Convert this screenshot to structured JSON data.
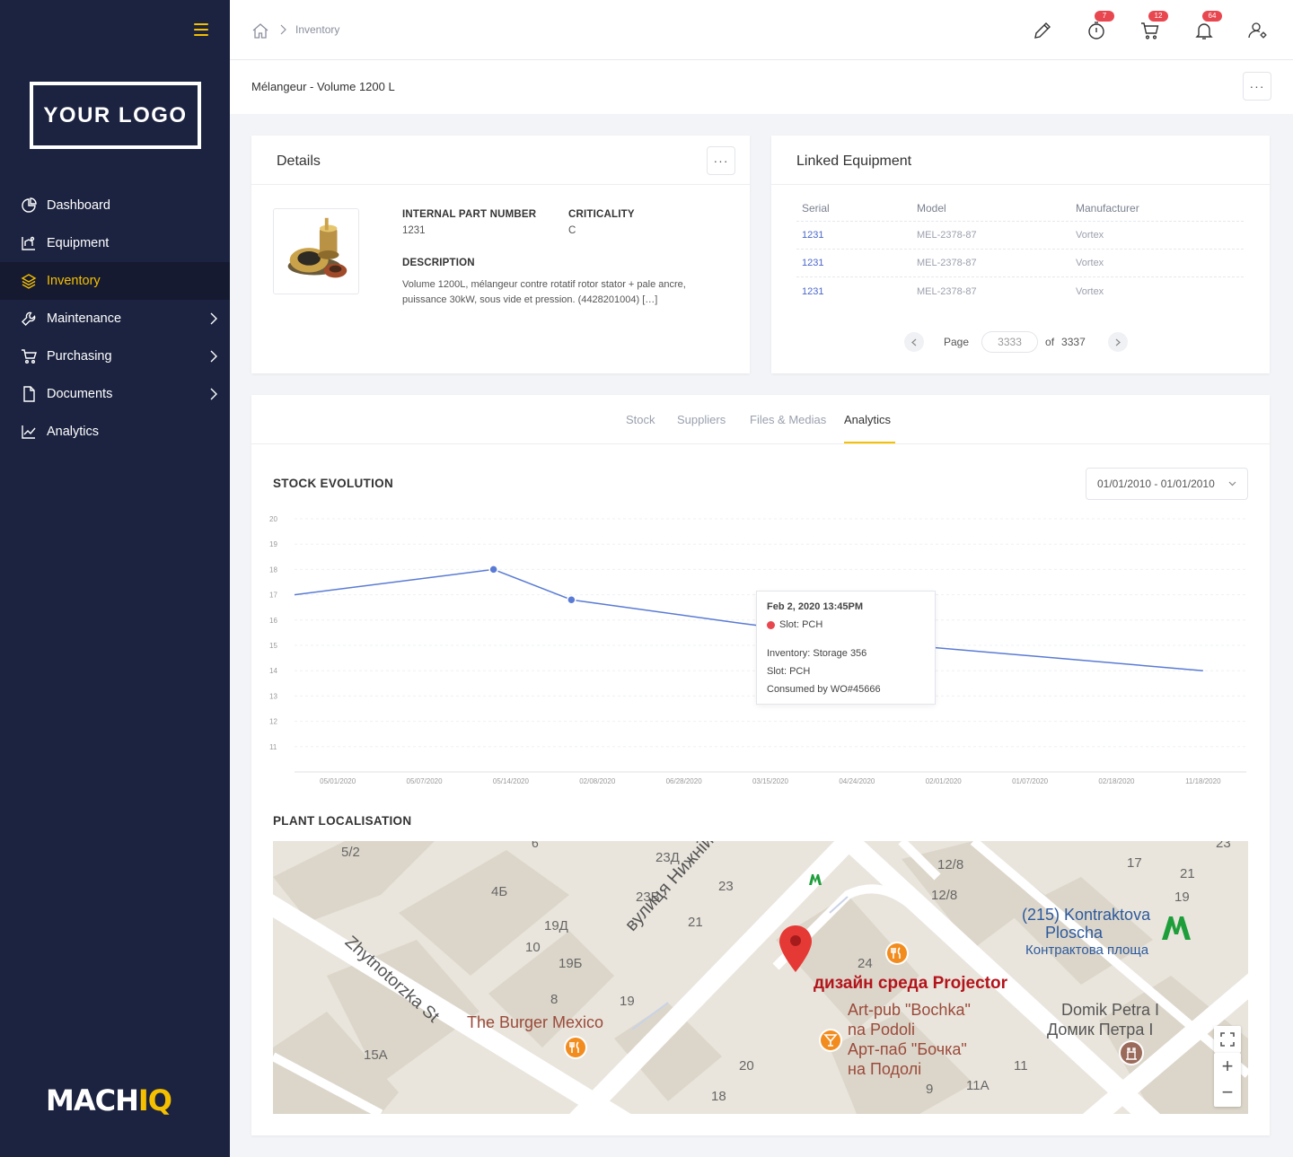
{
  "sidebar": {
    "logo_text": "YOUR LOGO",
    "items": [
      {
        "label": "Dashboard",
        "icon": "dashboard-icon",
        "active": false,
        "has_children": false
      },
      {
        "label": "Equipment",
        "icon": "equipment-icon",
        "active": false,
        "has_children": false
      },
      {
        "label": "Inventory",
        "icon": "inventory-layers-icon",
        "active": true,
        "has_children": false
      },
      {
        "label": "Maintenance",
        "icon": "wrench-icon",
        "active": false,
        "has_children": true
      },
      {
        "label": "Purchasing",
        "icon": "cart-icon",
        "active": false,
        "has_children": true
      },
      {
        "label": "Documents",
        "icon": "document-icon",
        "active": false,
        "has_children": true
      },
      {
        "label": "Analytics",
        "icon": "analytics-icon",
        "active": false,
        "has_children": false
      }
    ],
    "brand": {
      "part1": "MACH",
      "part2": "IQ"
    },
    "accent": "#f5c000",
    "background": "#1c2340"
  },
  "topbar": {
    "breadcrumb": "Inventory",
    "icons": [
      {
        "name": "pencil-icon",
        "badge": ""
      },
      {
        "name": "stopwatch-icon",
        "badge": "7"
      },
      {
        "name": "cart-icon",
        "badge": "12"
      },
      {
        "name": "bell-icon",
        "badge": "64"
      },
      {
        "name": "user-settings-icon",
        "badge": ""
      }
    ],
    "badge_color": "#e8474f"
  },
  "page": {
    "title": "Mélangeur - Volume 1200 L",
    "more_label": "···"
  },
  "details": {
    "title": "Details",
    "more_label": "···",
    "internal_part_number_label": "INTERNAL PART NUMBER",
    "internal_part_number": "1231",
    "criticality_label": "CRITICALITY",
    "criticality": "C",
    "description_label": "DESCRIPTION",
    "description": "Volume 1200L, mélangeur contre rotatif rotor stator + pale ancre, puissance 30kW, sous vide et pression. (4428201004) […]"
  },
  "linked_equipment": {
    "title": "Linked Equipment",
    "columns": [
      "Serial",
      "Model",
      "Manufacturer"
    ],
    "rows": [
      [
        "1231",
        "MEL-2378-87",
        "Vortex"
      ],
      [
        "1231",
        "MEL-2378-87",
        "Vortex"
      ],
      [
        "1231",
        "MEL-2378-87",
        "Vortex"
      ]
    ],
    "pager": {
      "page_label": "Page",
      "page_value": "3333",
      "of_label": "of",
      "total": "3337"
    }
  },
  "tabs": {
    "items": [
      "Stock",
      "Suppliers",
      "Files & Medias",
      "Analytics"
    ],
    "active": "Analytics"
  },
  "stock_evolution": {
    "title": "STOCK EVOLUTION",
    "date_range": "01/01/2010 - 01/01/2010"
  },
  "chart_data": {
    "type": "line",
    "title": "STOCK EVOLUTION",
    "x_ticks": [
      "05/01/2020",
      "05/07/2020",
      "05/14/2020",
      "02/08/2020",
      "06/28/2020",
      "03/15/2020",
      "04/24/2020",
      "02/01/2020",
      "01/07/2020",
      "02/18/2020",
      "11/18/2020"
    ],
    "y_ticks": [
      11,
      12,
      13,
      14,
      15,
      16,
      17,
      18,
      19,
      20
    ],
    "ylim": [
      10,
      20
    ],
    "series": [
      {
        "x_index": [
          0,
          2.3,
          3.2,
          5.1,
          7.1,
          10.5
        ],
        "values": [
          17,
          18,
          16.8,
          15.9,
          15,
          14
        ],
        "marked_points": [
          1,
          2
        ],
        "highlight_point": 4,
        "color": "#5a7bd5",
        "highlight_color": "#e8474f"
      }
    ],
    "tooltip": {
      "title": "Feb 2, 2020 13:45PM",
      "slot": "Slot: PCH",
      "lines": [
        "Inventory: Storage 356",
        "Slot: PCH",
        "Consumed by WO#45666"
      ]
    },
    "grid": true
  },
  "plant_localisation": {
    "title": "PLANT LOCALISATION",
    "map_labels": {
      "street1": "вулиця Нижній Вал",
      "street2": "Zhytnotorzka St",
      "poi_main": "дизайн среда Projector",
      "poi_burger": "The Burger Mexico",
      "poi_pub_1": "Art-pub \"Bochka\"",
      "poi_pub_2": "na Podoli",
      "poi_pub_3": "Арт-паб \"Бочка\"",
      "poi_pub_4": "на Подолі",
      "metro_1": "(215) Kontraktova",
      "metro_2": "Ploscha",
      "metro_3": "Контрактова площа",
      "domik_1": "Domik Petra I",
      "domik_2": "Домик Петра I",
      "numbers": [
        "5/2",
        "6",
        "23Д",
        "4Б",
        "23В",
        "23",
        "19Д",
        "21",
        "10",
        "19Б",
        "8",
        "19",
        "15А",
        "24",
        "20",
        "18",
        "9",
        "11",
        "11А",
        "12/8",
        "12/8",
        "17",
        "21",
        "19",
        "23"
      ]
    },
    "controls": {
      "fullscreen": "⛶",
      "zoom_in": "+",
      "zoom_out": "−"
    }
  }
}
